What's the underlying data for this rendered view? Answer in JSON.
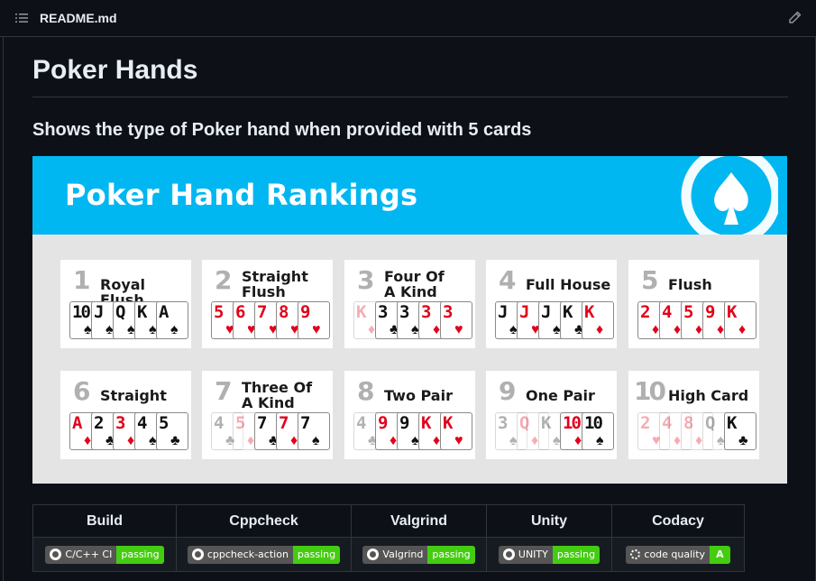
{
  "file": {
    "name": "README.md"
  },
  "readme": {
    "title": "Poker Hands",
    "subtitle": "Shows the type of Poker hand when provided with 5 cards"
  },
  "banner": {
    "title": "Poker Hand Rankings",
    "hands": [
      {
        "num": "1",
        "name": "Royal Flush",
        "cards": [
          [
            "10",
            "♠",
            "blk"
          ],
          [
            "J",
            "♠",
            "blk"
          ],
          [
            "Q",
            "♠",
            "blk"
          ],
          [
            "K",
            "♠",
            "blk"
          ],
          [
            "A",
            "♠",
            "blk"
          ]
        ]
      },
      {
        "num": "2",
        "name": "Straight Flush",
        "cards": [
          [
            "5",
            "♥",
            "red"
          ],
          [
            "6",
            "♥",
            "red"
          ],
          [
            "7",
            "♥",
            "red"
          ],
          [
            "8",
            "♥",
            "red"
          ],
          [
            "9",
            "♥",
            "red"
          ]
        ]
      },
      {
        "num": "3",
        "name": "Four Of A Kind",
        "cards": [
          [
            "K",
            "♦",
            "red dim"
          ],
          [
            "3",
            "♣",
            "blk"
          ],
          [
            "3",
            "♠",
            "blk"
          ],
          [
            "3",
            "♦",
            "red"
          ],
          [
            "3",
            "♥",
            "red"
          ]
        ]
      },
      {
        "num": "4",
        "name": "Full House",
        "cards": [
          [
            "J",
            "♠",
            "blk"
          ],
          [
            "J",
            "♥",
            "red"
          ],
          [
            "J",
            "♠",
            "blk"
          ],
          [
            "K",
            "♣",
            "blk"
          ],
          [
            "K",
            "♦",
            "red"
          ]
        ]
      },
      {
        "num": "5",
        "name": "Flush",
        "cards": [
          [
            "2",
            "♦",
            "red"
          ],
          [
            "4",
            "♦",
            "red"
          ],
          [
            "5",
            "♦",
            "red"
          ],
          [
            "9",
            "♦",
            "red"
          ],
          [
            "K",
            "♦",
            "red"
          ]
        ]
      },
      {
        "num": "6",
        "name": "Straight",
        "cards": [
          [
            "A",
            "♦",
            "red"
          ],
          [
            "2",
            "♣",
            "blk"
          ],
          [
            "3",
            "♦",
            "red"
          ],
          [
            "4",
            "♠",
            "blk"
          ],
          [
            "5",
            "♣",
            "blk"
          ]
        ]
      },
      {
        "num": "7",
        "name": "Three Of A Kind",
        "cards": [
          [
            "4",
            "♣",
            "blk dim"
          ],
          [
            "5",
            "♦",
            "red dim"
          ],
          [
            "7",
            "♣",
            "blk"
          ],
          [
            "7",
            "♦",
            "red"
          ],
          [
            "7",
            "♠",
            "blk"
          ]
        ]
      },
      {
        "num": "8",
        "name": "Two Pair",
        "cards": [
          [
            "4",
            "♣",
            "blk dim"
          ],
          [
            "9",
            "♦",
            "red"
          ],
          [
            "9",
            "♠",
            "blk"
          ],
          [
            "K",
            "♦",
            "red"
          ],
          [
            "K",
            "♥",
            "red"
          ]
        ]
      },
      {
        "num": "9",
        "name": "One Pair",
        "cards": [
          [
            "3",
            "♠",
            "blk dim"
          ],
          [
            "Q",
            "♦",
            "red dim"
          ],
          [
            "K",
            "♠",
            "blk dim"
          ],
          [
            "10",
            "♦",
            "red"
          ],
          [
            "10",
            "♠",
            "blk"
          ]
        ]
      },
      {
        "num": "10",
        "name": "High Card",
        "cards": [
          [
            "2",
            "♥",
            "red dim"
          ],
          [
            "4",
            "♦",
            "red dim"
          ],
          [
            "8",
            "♦",
            "red dim"
          ],
          [
            "Q",
            "♠",
            "blk dim"
          ],
          [
            "K",
            "♣",
            "blk"
          ]
        ]
      }
    ]
  },
  "badges": {
    "headers": [
      "Build",
      "Cppcheck",
      "Valgrind",
      "Unity",
      "Codacy"
    ],
    "items": [
      {
        "label": "C/C++ CI",
        "status": "passing",
        "icon": "github-icon"
      },
      {
        "label": "cppcheck-action",
        "status": "passing",
        "icon": "github-icon"
      },
      {
        "label": "Valgrind",
        "status": "passing",
        "icon": "github-icon"
      },
      {
        "label": "UNITY",
        "status": "passing",
        "icon": "github-icon"
      },
      {
        "label": "code quality",
        "status": "A",
        "icon": "codacy-icon"
      }
    ]
  },
  "colors": {
    "banner_blue": "#00b7f1",
    "card_red": "#e2001a",
    "badge_green": "#44cc11"
  }
}
